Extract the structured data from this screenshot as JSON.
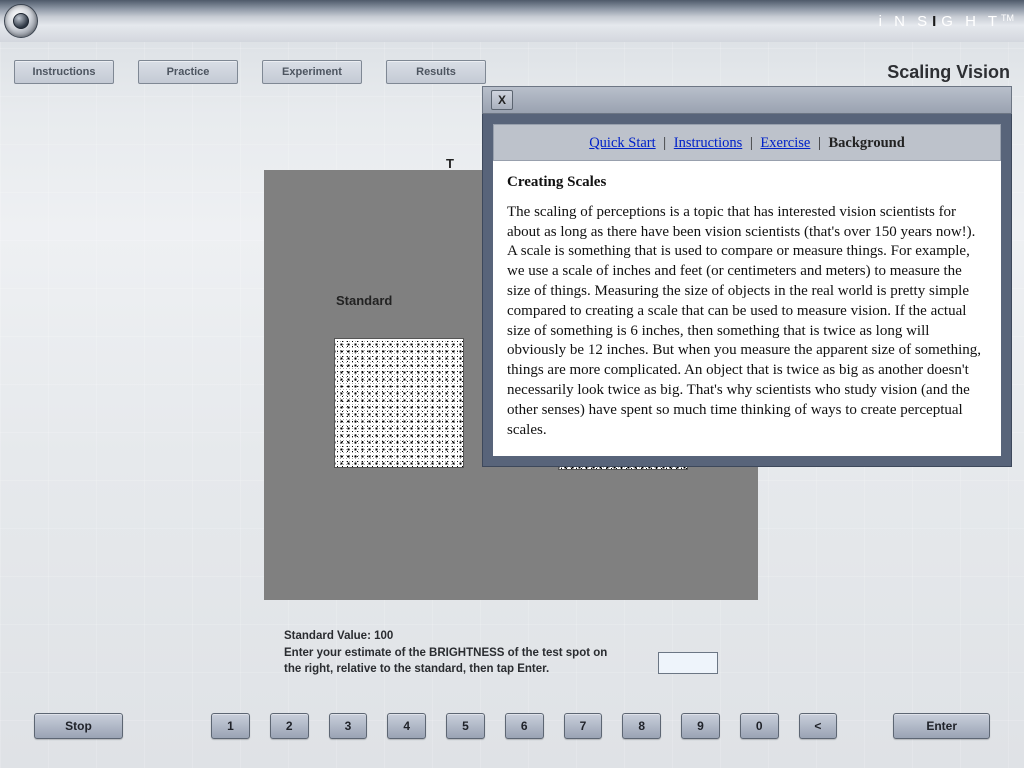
{
  "brand": {
    "text_pre": "i N S",
    "text_dark": "I",
    "text_post": "G H T",
    "tm": "TM"
  },
  "nav": {
    "instructions": "Instructions",
    "practice": "Practice",
    "experiment": "Experiment",
    "results": "Results",
    "title": "Scaling Vision"
  },
  "stage": {
    "standard_label": "Standard",
    "t_label": "T"
  },
  "under": {
    "line1": "Standard Value: 100",
    "line2": "Enter your estimate of the BRIGHTNESS of the test spot on",
    "line3": "the right, relative to the standard, then tap Enter."
  },
  "input": {
    "value": ""
  },
  "keypad": {
    "stop": "Stop",
    "keys": [
      "1",
      "2",
      "3",
      "4",
      "5",
      "6",
      "7",
      "8",
      "9",
      "0",
      "<"
    ],
    "enter": "Enter"
  },
  "popup": {
    "x": "X",
    "links": {
      "quick": "Quick Start",
      "instr": "Instructions",
      "ex": "Exercise",
      "bg": "Background"
    },
    "heading": "Creating Scales",
    "body": "The scaling of perceptions is a topic that has interested vision scientists for about as long as there have been vision scientists (that's over 150 years now!). A scale is something that is used to compare or measure things. For example, we use a scale of inches and feet (or centimeters and meters) to measure the size of things. Measuring the size of objects in the real world is pretty simple compared to creating a scale that can be used to measure vision. If the actual size of something is 6 inches, then something that is twice as long will obviously be 12 inches. But when you measure the apparent size of something, things are more complicated. An object that is twice as big as another doesn't necessarily look twice as big. That's why scientists who study vision (and the other senses) have spent so much time thinking of ways to create perceptual scales."
  }
}
